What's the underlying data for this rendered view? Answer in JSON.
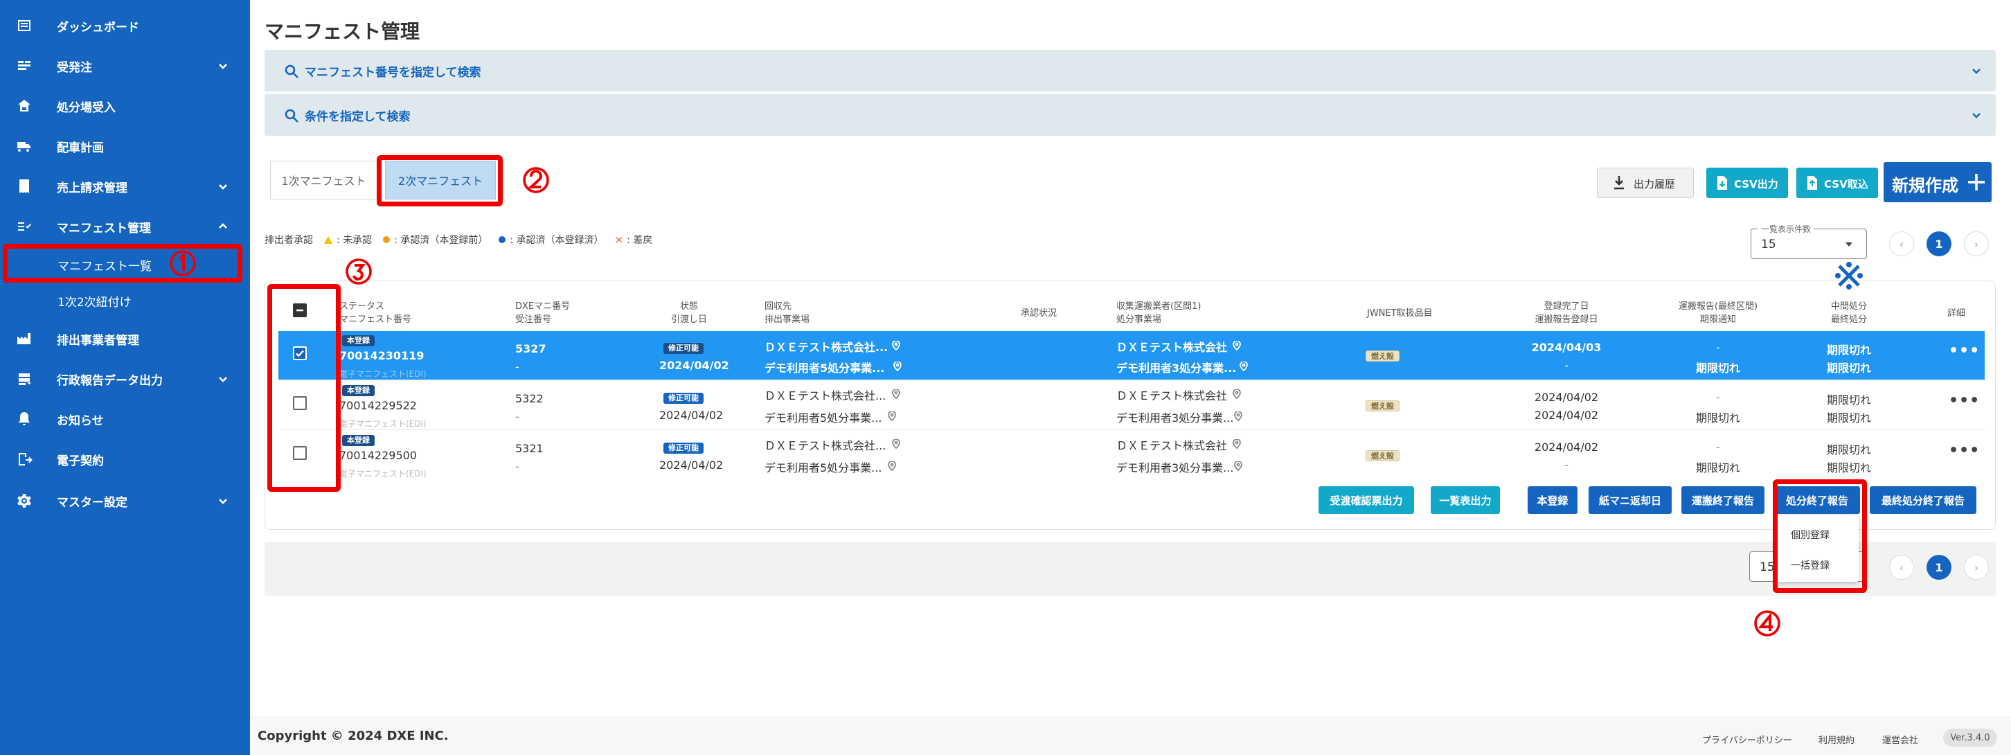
{
  "sidebar": {
    "items": [
      {
        "label": "ダッシュボード",
        "icon": "dashboard-icon"
      },
      {
        "label": "受発注",
        "icon": "order-icon"
      },
      {
        "label": "処分場受入",
        "icon": "facility-icon"
      },
      {
        "label": "配車計画",
        "icon": "truck-icon"
      },
      {
        "label": "売上請求管理",
        "icon": "invoice-icon"
      },
      {
        "label": "マニフェスト管理",
        "icon": "manifest-icon"
      },
      {
        "label": "排出事業者管理",
        "icon": "factory-icon"
      },
      {
        "label": "行政報告データ出力",
        "icon": "database-icon"
      },
      {
        "label": "お知らせ",
        "icon": "bell-icon"
      },
      {
        "label": "電子契約",
        "icon": "contract-icon"
      },
      {
        "label": "マスター設定",
        "icon": "gear-icon"
      }
    ],
    "sub_items": {
      "list": "マニフェスト一覧",
      "link": "1次2次紐付け"
    }
  },
  "page": {
    "title": "マニフェスト管理",
    "search_by_number": "マニフェスト番号を指定して検索",
    "search_by_condition": "条件を指定して検索"
  },
  "tabs": {
    "primary": "1次マニフェスト",
    "secondary": "2次マニフェスト"
  },
  "toolbar": {
    "history": "出力履歴",
    "csv_out": "CSV出力",
    "csv_in": "CSV取込",
    "new": "新規作成"
  },
  "legend": {
    "title": "排出者承認",
    "unapproved": ": 未承認",
    "approved_unreg": ": 承認済（本登録前）",
    "approved_reg": ": 承認済（本登録済）",
    "rejected": ": 差戻"
  },
  "colors": {
    "unapproved": "#f2c200",
    "approved_unreg": "#f39c12",
    "approved_reg": "#1565c0",
    "rejected": "#e74c3c"
  },
  "pager": {
    "legend": "一覧表示件数",
    "value": "15",
    "page": "1"
  },
  "table": {
    "headers": {
      "status": [
        "ステータス",
        "マニフェスト番号"
      ],
      "dxe": [
        "DXEマニ番号",
        "受注番号"
      ],
      "state": [
        "状態",
        "引渡し日"
      ],
      "collect": [
        "回収先",
        "排出事業場"
      ],
      "approval": "承認状況",
      "transport": [
        "収集運搬業者(区間1)",
        "処分事業場"
      ],
      "jwnet": "JWNET取扱品目",
      "regdate": [
        "登録完了日",
        "運搬報告登録日"
      ],
      "report": [
        "運搬報告(最終区間)",
        "期限通知"
      ],
      "disposal": [
        "中間処分",
        "最終処分"
      ],
      "detail": "詳細"
    },
    "rows": [
      {
        "badge": "本登録",
        "manifest": "70014230119",
        "edi": "電子マニフェスト(EDI)",
        "dxe": "5327",
        "order": "-",
        "state": "修正可能",
        "date": "2024/04/02",
        "collector": "ＤＸＥテスト株式会社...",
        "site": "デモ利用者5処分事業...",
        "transporter": "ＤＸＥテスト株式会社",
        "facility": "デモ利用者3処分事業...",
        "jwnet": "燃え殻",
        "reg": "2024/04/03",
        "regreport": "-",
        "report": "-",
        "deadline": "期限切れ",
        "mid": "期限切れ",
        "final": "期限切れ"
      },
      {
        "badge": "本登録",
        "manifest": "70014229522",
        "edi": "電子マニフェスト(EDI)",
        "dxe": "5322",
        "order": "-",
        "state": "修正可能",
        "date": "2024/04/02",
        "collector": "ＤＸＥテスト株式会社...",
        "site": "デモ利用者5処分事業...",
        "transporter": "ＤＸＥテスト株式会社",
        "facility": "デモ利用者3処分事業...",
        "jwnet": "燃え殻",
        "reg": "2024/04/02",
        "regreport": "2024/04/02",
        "report": "-",
        "deadline": "期限切れ",
        "mid": "期限切れ",
        "final": "期限切れ"
      },
      {
        "badge": "本登録",
        "manifest": "70014229500",
        "edi": "電子マニフェスト(EDI)",
        "dxe": "5321",
        "order": "-",
        "state": "修正可能",
        "date": "2024/04/02",
        "collector": "ＤＸＥテスト株式会社...",
        "site": "デモ利用者5処分事業...",
        "transporter": "ＤＸＥテスト株式会社",
        "facility": "デモ利用者3処分事業...",
        "jwnet": "燃え殻",
        "reg": "2024/04/02",
        "regreport": "-",
        "report": "-",
        "deadline": "期限切れ",
        "mid": "期限切れ",
        "final": "期限切れ"
      }
    ]
  },
  "actions": {
    "receipt": "受渡確認票出力",
    "list_out": "一覧表出力",
    "register": "本登録",
    "paper": "紙マニ返却日",
    "transport_end": "運搬終了報告",
    "disposal_end": "処分終了報告",
    "final_end": "最終処分終了報告"
  },
  "dropdown": {
    "individual": "個別登録",
    "bulk": "一括登録"
  },
  "annotations": {
    "n1": "①",
    "n2": "②",
    "n3": "③",
    "n4": "④",
    "mark": "※"
  },
  "footer": {
    "copyright": "Copyright © 2024 DXE INC.",
    "privacy": "プライバシーポリシー",
    "terms": "利用規約",
    "company": "運営会社",
    "version": "Ver.3.4.0"
  }
}
